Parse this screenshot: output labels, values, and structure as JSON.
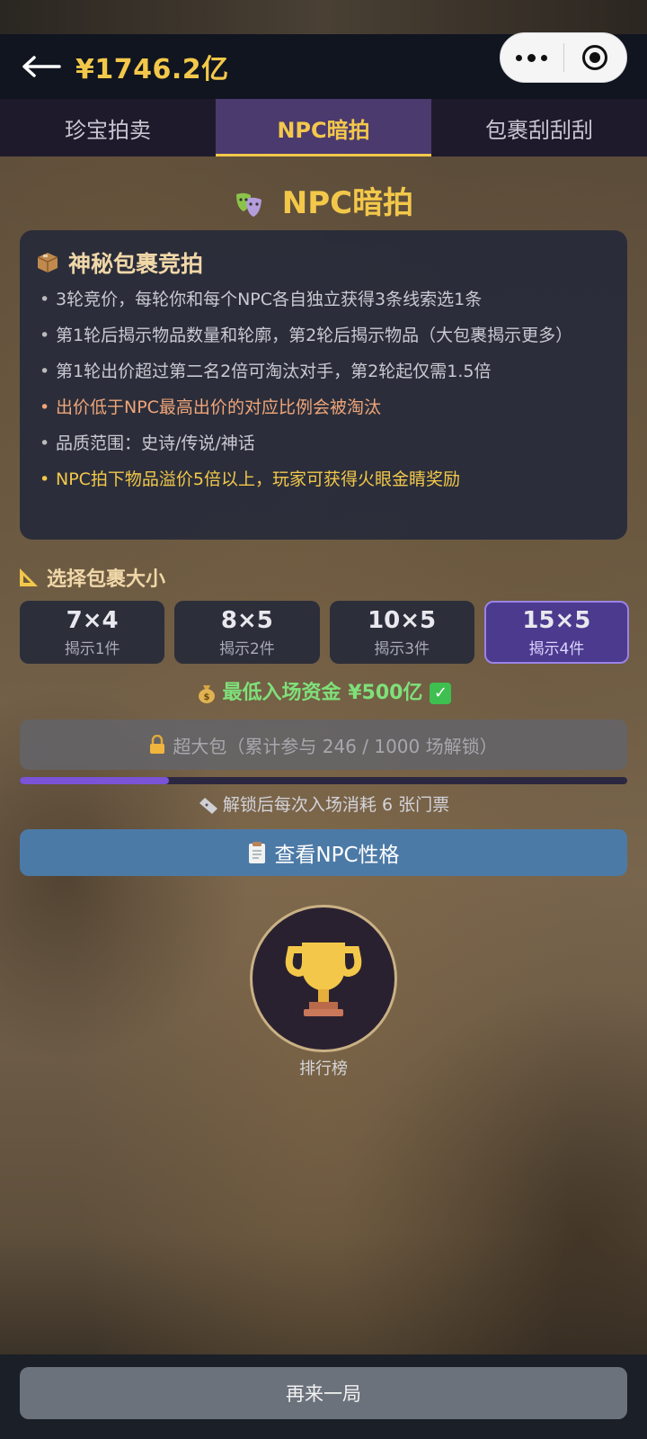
{
  "header": {
    "balance": "¥1746.2亿"
  },
  "tabs": [
    {
      "label": "珍宝拍卖"
    },
    {
      "label": "NPC暗拍"
    },
    {
      "label": "包裹刮刮刮"
    }
  ],
  "page": {
    "title": "NPC暗拍"
  },
  "info": {
    "heading": "神秘包裹竞拍",
    "rules": [
      "3轮竞价，每轮你和每个NPC各自独立获得3条线索选1条",
      "第1轮后揭示物品数量和轮廓，第2轮后揭示物品（大包裹揭示更多）",
      "第1轮出价超过第二名2倍可淘汰对手，第2轮起仅需1.5倍",
      "出价低于NPC最高出价的对应比例会被淘汰",
      "品质范围：史诗/传说/神话",
      "NPC拍下物品溢价5倍以上，玩家可获得火眼金睛奖励"
    ]
  },
  "sizes": {
    "label": "选择包裹大小",
    "options": [
      {
        "dim": "7×4",
        "reveal": "揭示1件"
      },
      {
        "dim": "8×5",
        "reveal": "揭示2件"
      },
      {
        "dim": "10×5",
        "reveal": "揭示3件"
      },
      {
        "dim": "15×5",
        "reveal": "揭示4件"
      }
    ],
    "selected": "15×5"
  },
  "min_fund": "最低入场资金 ¥500亿",
  "bigpack": {
    "label": "超大包（累计参与 246 / 1000 场解锁）",
    "progress": 0.246,
    "note": "解锁后每次入场消耗 6 张门票"
  },
  "npc_button": "查看NPC性格",
  "leaderboard": "排行榜",
  "bottom": {
    "again": "再来一局"
  },
  "colors": {
    "gold": "#f3c84a",
    "purple": "#4b3a8e",
    "blue": "#4c7aa7",
    "green": "#7fe07a"
  }
}
